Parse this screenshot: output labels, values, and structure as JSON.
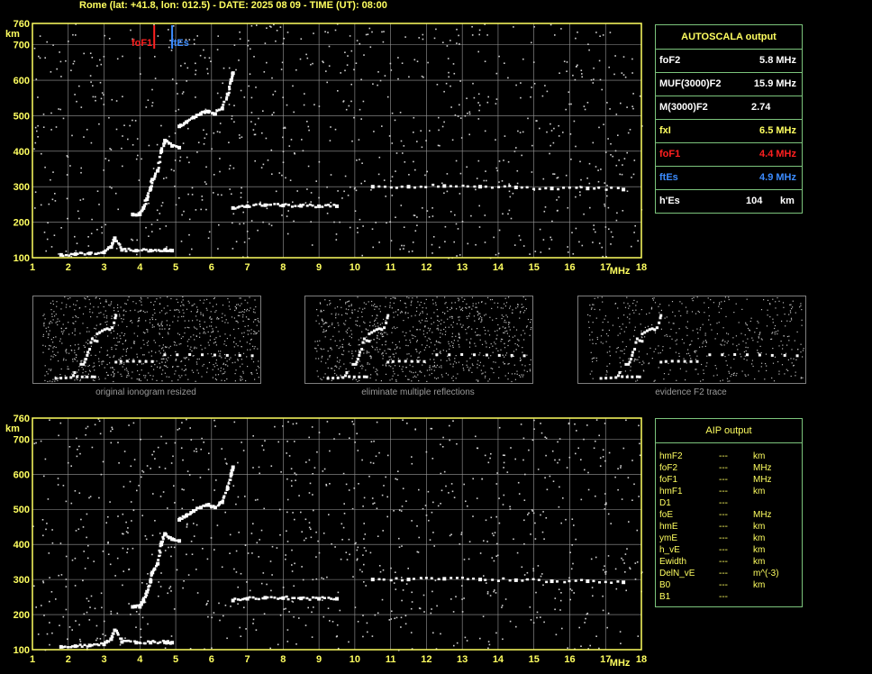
{
  "title": "Rome (lat: +41.8, lon: 012.5) - DATE: 2025 08 09 - TIME (UT): 08:00",
  "chart_data": [
    {
      "type": "scatter",
      "title": "",
      "xlabel": "MHz",
      "ylabel": "km",
      "xlim": [
        1,
        18
      ],
      "ylim": [
        100,
        760
      ],
      "x_ticks": [
        1,
        2,
        3,
        4,
        5,
        6,
        7,
        8,
        9,
        10,
        11,
        12,
        13,
        14,
        15,
        16,
        17,
        18
      ],
      "y_ticks": [
        100,
        200,
        300,
        400,
        500,
        600,
        700,
        760
      ],
      "grid": true,
      "markers": [
        {
          "label": "foF1",
          "x": 4.4,
          "color": "#ff2020"
        },
        {
          "label": "ftEs",
          "x": 4.9,
          "color": "#3c8cff"
        }
      ],
      "traces": [
        {
          "name": "E / Es",
          "points": [
            [
              1.8,
              108
            ],
            [
              2.2,
              110
            ],
            [
              2.6,
              112
            ],
            [
              3.0,
              115
            ],
            [
              3.2,
              130
            ],
            [
              3.3,
              155
            ],
            [
              3.5,
              122
            ],
            [
              3.9,
              120
            ],
            [
              4.3,
              120
            ],
            [
              4.7,
              121
            ],
            [
              4.9,
              120
            ]
          ]
        },
        {
          "name": "F1",
          "points": [
            [
              3.8,
              222
            ],
            [
              4.0,
              222
            ],
            [
              4.1,
              240
            ],
            [
              4.2,
              265
            ],
            [
              4.3,
              295
            ],
            [
              4.35,
              320
            ],
            [
              4.5,
              345
            ],
            [
              4.6,
              400
            ],
            [
              4.7,
              430
            ],
            [
              4.9,
              415
            ],
            [
              5.1,
              410
            ]
          ]
        },
        {
          "name": "F2",
          "points": [
            [
              5.1,
              470
            ],
            [
              5.3,
              482
            ],
            [
              5.5,
              495
            ],
            [
              5.7,
              505
            ],
            [
              5.9,
              512
            ],
            [
              6.1,
              505
            ],
            [
              6.3,
              520
            ],
            [
              6.45,
              560
            ],
            [
              6.55,
              600
            ],
            [
              6.6,
              620
            ]
          ]
        },
        {
          "name": "2F",
          "points": [
            [
              6.6,
              240
            ],
            [
              7.0,
              245
            ],
            [
              7.5,
              248
            ],
            [
              8.0,
              247
            ],
            [
              8.5,
              246
            ],
            [
              9.0,
              245
            ],
            [
              9.5,
              245
            ]
          ]
        },
        {
          "name": "high",
          "points": [
            [
              10.5,
              300
            ],
            [
              11.5,
              300
            ],
            [
              12.5,
              302
            ],
            [
              13.5,
              300
            ],
            [
              14.5,
              298
            ],
            [
              15.5,
              295
            ],
            [
              16.5,
              295
            ],
            [
              17.5,
              292
            ]
          ]
        }
      ]
    },
    {
      "type": "scatter",
      "title": "",
      "xlabel": "MHz",
      "ylabel": "km",
      "xlim": [
        1,
        18
      ],
      "ylim": [
        100,
        760
      ],
      "x_ticks": [
        1,
        2,
        3,
        4,
        5,
        6,
        7,
        8,
        9,
        10,
        11,
        12,
        13,
        14,
        15,
        16,
        17,
        18
      ],
      "y_ticks": [
        100,
        200,
        300,
        400,
        500,
        600,
        700,
        760
      ],
      "grid": true
    }
  ],
  "autoscala": {
    "heading": "AUTOSCALA output",
    "rows": [
      {
        "param": "foF2",
        "value": "5.8 MHz",
        "color": "#ffffff"
      },
      {
        "param": "MUF(3000)F2",
        "value": "15.9 MHz",
        "color": "#ffffff"
      },
      {
        "param": "M(3000)F2",
        "value": "2.74",
        "color": "#ffffff"
      },
      {
        "param": "fxI",
        "value": "6.5 MHz",
        "color": "#ffff60"
      },
      {
        "param": "foF1",
        "value": "4.4 MHz",
        "color": "#ff2020"
      },
      {
        "param": "ftEs",
        "value": "4.9 MHz",
        "color": "#3c8cff"
      },
      {
        "param": "h'Es",
        "value": "104",
        "unit": "km",
        "color": "#ffffff"
      }
    ]
  },
  "aip": {
    "heading": "AIP output",
    "rows": [
      {
        "param": "hmF2",
        "value": "---",
        "unit": "km"
      },
      {
        "param": "foF2",
        "value": "---",
        "unit": "MHz"
      },
      {
        "param": "foF1",
        "value": "---",
        "unit": "MHz"
      },
      {
        "param": "hmF1",
        "value": "---",
        "unit": "km"
      },
      {
        "param": "D1",
        "value": "---",
        "unit": ""
      },
      {
        "param": "foE",
        "value": "---",
        "unit": "MHz"
      },
      {
        "param": "hmE",
        "value": "---",
        "unit": "km"
      },
      {
        "param": "ymE",
        "value": "---",
        "unit": "km"
      },
      {
        "param": "h_vE",
        "value": "---",
        "unit": "km"
      },
      {
        "param": "Ewidth",
        "value": "---",
        "unit": "km"
      },
      {
        "param": "DelN_vE",
        "value": "---",
        "unit": "m^(-3)"
      },
      {
        "param": "B0",
        "value": "---",
        "unit": "km"
      },
      {
        "param": "B1",
        "value": "---",
        "unit": ""
      }
    ]
  },
  "thumbnails": [
    {
      "caption": "original ionogram resized"
    },
    {
      "caption": "eliminate multiple reflections"
    },
    {
      "caption": "evidence F2 trace"
    }
  ],
  "colors": {
    "frame": "#ffff60",
    "grid": "#9a9a9a",
    "table_border": "#7cc47c",
    "trace": "#ffffff"
  }
}
